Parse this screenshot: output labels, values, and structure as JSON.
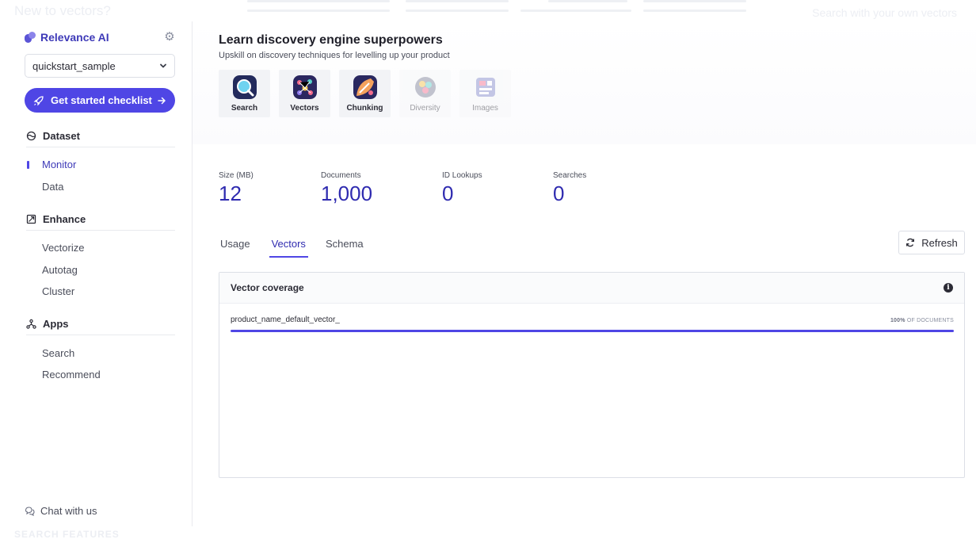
{
  "background": {
    "title": "New to vectors?",
    "search_hint": "Search with your own vectors",
    "footer": "SEARCH FEATURES"
  },
  "sidebar": {
    "brand": "Relevance AI",
    "dataset_select": {
      "value": "quickstart_sample"
    },
    "checklist_button": "Get started checklist",
    "sections": {
      "dataset": {
        "label": "Dataset",
        "items": [
          "Monitor",
          "Data"
        ]
      },
      "enhance": {
        "label": "Enhance",
        "items": [
          "Vectorize",
          "Autotag",
          "Cluster"
        ]
      },
      "apps": {
        "label": "Apps",
        "items": [
          "Search",
          "Recommend"
        ]
      }
    },
    "active_item": "Monitor",
    "chat": "Chat with us"
  },
  "hero": {
    "title": "Learn discovery engine superpowers",
    "subtitle": "Upskill on discovery techniques for levelling up your product",
    "tiles": [
      {
        "label": "Search",
        "icon": "search-illustration-icon",
        "enabled": true
      },
      {
        "label": "Vectors",
        "icon": "vectors-illustration-icon",
        "enabled": true
      },
      {
        "label": "Chunking",
        "icon": "chunking-illustration-icon",
        "enabled": true
      },
      {
        "label": "Diversity",
        "icon": "diversity-illustration-icon",
        "enabled": false
      },
      {
        "label": "Images",
        "icon": "images-illustration-icon",
        "enabled": false
      }
    ]
  },
  "stats": [
    {
      "label": "Size (MB)",
      "value": "12"
    },
    {
      "label": "Documents",
      "value": "1,000"
    },
    {
      "label": "ID Lookups",
      "value": "0"
    },
    {
      "label": "Searches",
      "value": "0"
    }
  ],
  "tabs": [
    "Usage",
    "Vectors",
    "Schema"
  ],
  "active_tab": "Vectors",
  "refresh_label": "Refresh",
  "vector_coverage": {
    "title": "Vector coverage",
    "rows": [
      {
        "field": "product_name_default_vector_",
        "percent": "100%",
        "suffix": "OF DOCUMENTS",
        "fraction": 1.0
      }
    ]
  },
  "colors": {
    "accent": "#4f46e5",
    "brand": "#3e3ab8",
    "stat_value": "#2f2bb0"
  }
}
